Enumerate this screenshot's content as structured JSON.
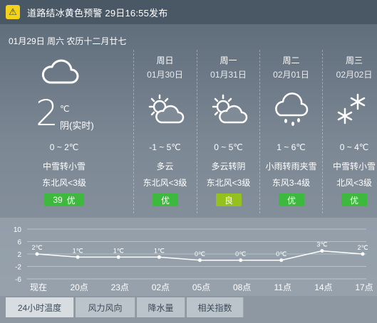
{
  "alert": {
    "text": "道路结冰黄色预警 29日16:55发布",
    "icon": "alert-icon"
  },
  "date_line": "01月29日  周六  农历十二月廿七",
  "today": {
    "temp": "2",
    "unit": "℃",
    "desc": "阴(实时)",
    "range": "0 ~ 2℃",
    "condition": "中雪转小雪",
    "wind": "东北风<3级",
    "aqi_value": "39",
    "aqi_label": "优",
    "icon": "cloud-icon"
  },
  "days": [
    {
      "name": "周日",
      "date": "01月30日",
      "range": "-1 ~ 5℃",
      "condition": "多云",
      "wind": "东北风<3级",
      "aqi": "优",
      "aqi_color": "#3dba3d",
      "icon": "partly-cloudy-sun-icon"
    },
    {
      "name": "周一",
      "date": "01月31日",
      "range": "0 ~ 5℃",
      "condition": "多云转阴",
      "wind": "东北风<3级",
      "aqi": "良",
      "aqi_color": "#95c11f",
      "icon": "partly-cloudy-sun-icon"
    },
    {
      "name": "周二",
      "date": "02月01日",
      "range": "1 ~ 6℃",
      "condition": "小雨转雨夹雪",
      "wind": "东风3-4级",
      "aqi": "优",
      "aqi_color": "#3dba3d",
      "icon": "rain-cloud-icon"
    },
    {
      "name": "周三",
      "date": "02月02日",
      "range": "0 ~ 4℃",
      "condition": "中雪转小雪",
      "wind": "北风<3级",
      "aqi": "优",
      "aqi_color": "#3dba3d",
      "icon": "snowflake-icon"
    }
  ],
  "chart_data": {
    "type": "line",
    "categories": [
      "现在",
      "20点",
      "23点",
      "02点",
      "05点",
      "08点",
      "11点",
      "14点",
      "17点"
    ],
    "values": [
      2,
      1,
      1,
      1,
      0,
      0,
      0,
      3,
      2
    ],
    "point_labels": [
      "2℃",
      "1℃",
      "1℃",
      "1℃",
      "0℃",
      "0℃",
      "0℃",
      "3℃",
      "2℃"
    ],
    "yticks": [
      "10",
      "6",
      "2",
      "-2",
      "-6"
    ],
    "ylim": [
      -6,
      10
    ],
    "grid": true,
    "line_color": "#ffffff"
  },
  "tabs": [
    "24小时温度",
    "风力风向",
    "降水量",
    "相关指数"
  ]
}
